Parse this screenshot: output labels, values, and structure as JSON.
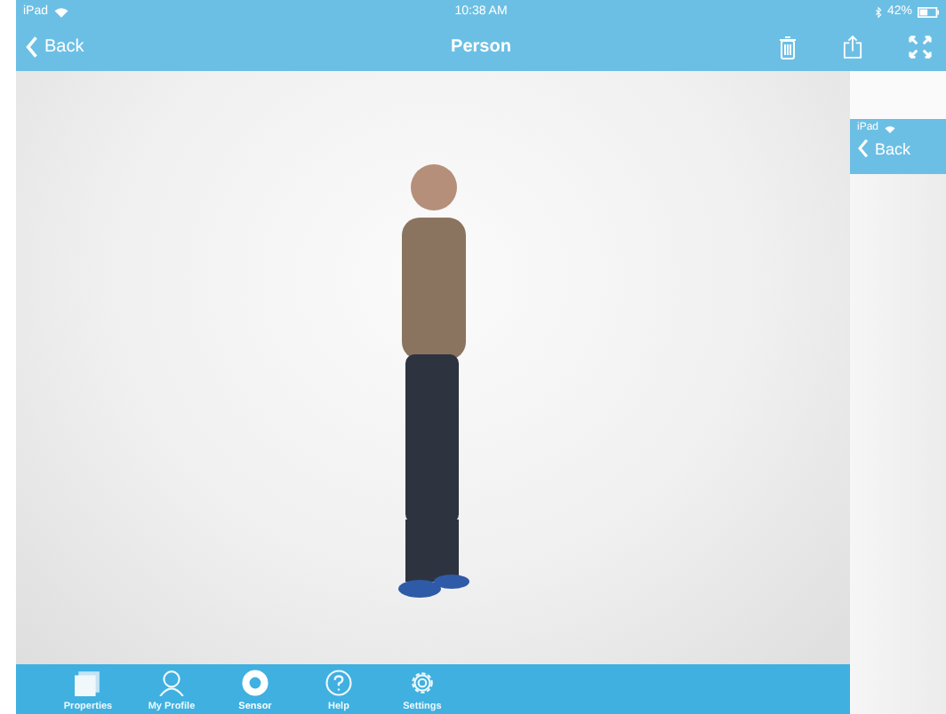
{
  "status_bar": {
    "carrier": "iPad",
    "time": "10:38 AM",
    "battery": "42%"
  },
  "nav_bar": {
    "back": "Back",
    "title": "Person"
  },
  "bottom_tabs": [
    {
      "label": "Properties",
      "kind": "squares",
      "selected": false
    },
    {
      "label": "My Profile",
      "kind": "person",
      "selected": false
    },
    {
      "label": "Sensor",
      "kind": "sensor",
      "selected": true
    },
    {
      "label": "Help",
      "kind": "help",
      "selected": false
    },
    {
      "label": "Settings",
      "kind": "gear",
      "selected": false
    }
  ],
  "side_screen": {
    "carrier": "iPad",
    "back": "Back"
  }
}
